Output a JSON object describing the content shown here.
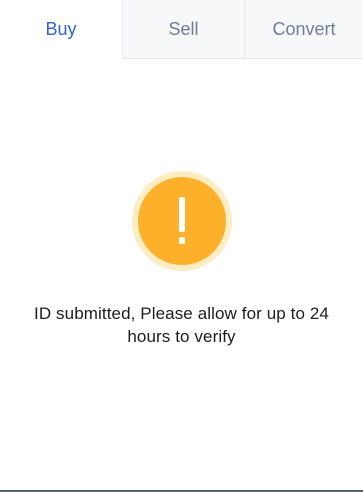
{
  "tabs": [
    {
      "label": "Buy",
      "active": true
    },
    {
      "label": "Sell",
      "active": false
    },
    {
      "label": "Convert",
      "active": false
    }
  ],
  "status": {
    "icon": "exclamation-icon",
    "message": "ID submitted, Please allow for up to 24 hours to verify"
  },
  "colors": {
    "active_tab": "#2f63d6",
    "inactive_tab": "#6d7e95",
    "warning": "#fdb02a",
    "warning_halo": "#fcedc3"
  }
}
